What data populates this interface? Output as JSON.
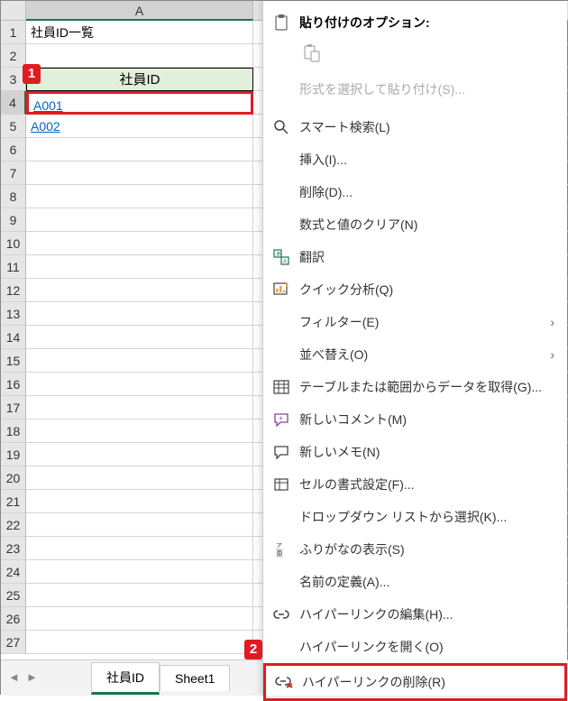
{
  "columns": {
    "A": "A"
  },
  "rows": [
    "1",
    "2",
    "3",
    "4",
    "5",
    "6",
    "7",
    "8",
    "9",
    "10",
    "11",
    "12",
    "13",
    "14",
    "15",
    "16",
    "17",
    "18",
    "19",
    "20",
    "21",
    "22",
    "23",
    "24",
    "25",
    "26",
    "27"
  ],
  "cells": {
    "A1": "社員ID一覧",
    "A3": "社員ID",
    "A4": "A001",
    "A5": "A002"
  },
  "tabs": {
    "active": "社員ID",
    "other": "Sheet1"
  },
  "callouts": {
    "c1": "1",
    "c2": "2"
  },
  "menu": {
    "paste_options_title": "貼り付けのオプション:",
    "paste_special": "形式を選択して貼り付け(S)...",
    "smart_lookup": "スマート検索(L)",
    "insert": "挿入(I)...",
    "delete": "削除(D)...",
    "clear": "数式と値のクリア(N)",
    "translate": "翻訳",
    "quick_analysis": "クイック分析(Q)",
    "filter": "フィルター(E)",
    "sort": "並べ替え(O)",
    "get_data": "テーブルまたは範囲からデータを取得(G)...",
    "new_comment": "新しいコメント(M)",
    "new_note": "新しいメモ(N)",
    "format_cells": "セルの書式設定(F)...",
    "dropdown": "ドロップダウン リストから選択(K)...",
    "furigana": "ふりがなの表示(S)",
    "define_name": "名前の定義(A)...",
    "edit_hyperlink": "ハイパーリンクの編集(H)...",
    "open_hyperlink": "ハイパーリンクを開く(O)",
    "remove_hyperlink": "ハイパーリンクの削除(R)"
  }
}
